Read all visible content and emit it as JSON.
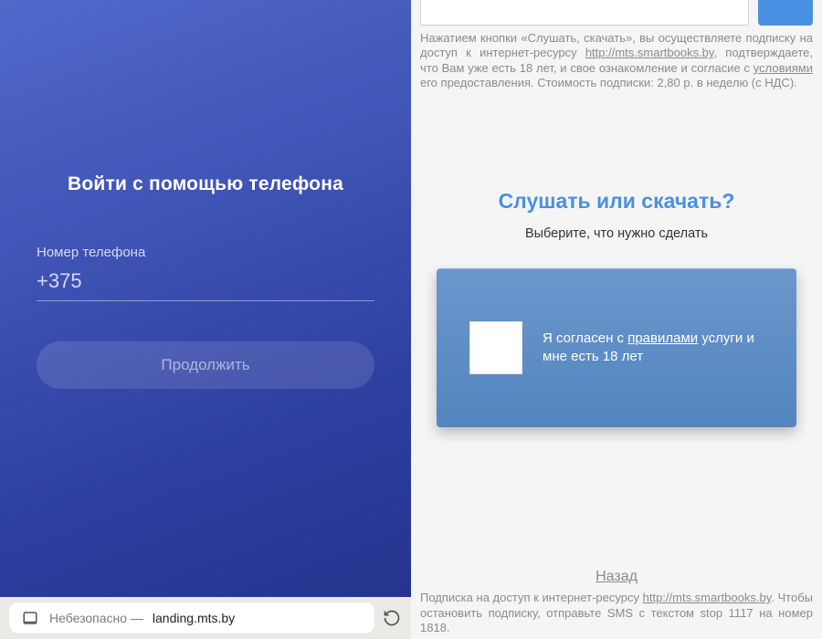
{
  "left": {
    "title": "Войти с помощью телефона",
    "phone_label": "Номер телефона",
    "phone_value": "+375",
    "continue_label": "Продолжить",
    "browser": {
      "insecure_prefix": "Небезопасно — ",
      "domain": "landing.mts.by"
    }
  },
  "right": {
    "top_terms_pre": "Нажатием кнопки «Слушать, скачать», вы осуществляете подписку на доступ к интернет-ресурсу ",
    "top_terms_url": "http://mts.smartbooks.by",
    "top_terms_mid": ", подтверждаете, что Вам уже есть 18 лет, и свое ознакомление и согласие с ",
    "top_terms_link": "условиями",
    "top_terms_post": " его предоставления. Стоимость подписки: 2,80 р. в неделю (с НДС).",
    "mid_title": "Слушать или скачать?",
    "mid_sub": "Выберите, что нужно сделать",
    "consent_pre": "Я согласен с ",
    "consent_link": "правилами",
    "consent_post": " услуги и мне есть 18 лет",
    "back_label": "Назад",
    "footer_pre": "Подписка на доступ к интернет-ресурсу ",
    "footer_url": "http://mts.smartbooks.by",
    "footer_post": ". Чтобы остановить подписку, отправьте SMS с текстом stop 1117 на номер 1818."
  }
}
